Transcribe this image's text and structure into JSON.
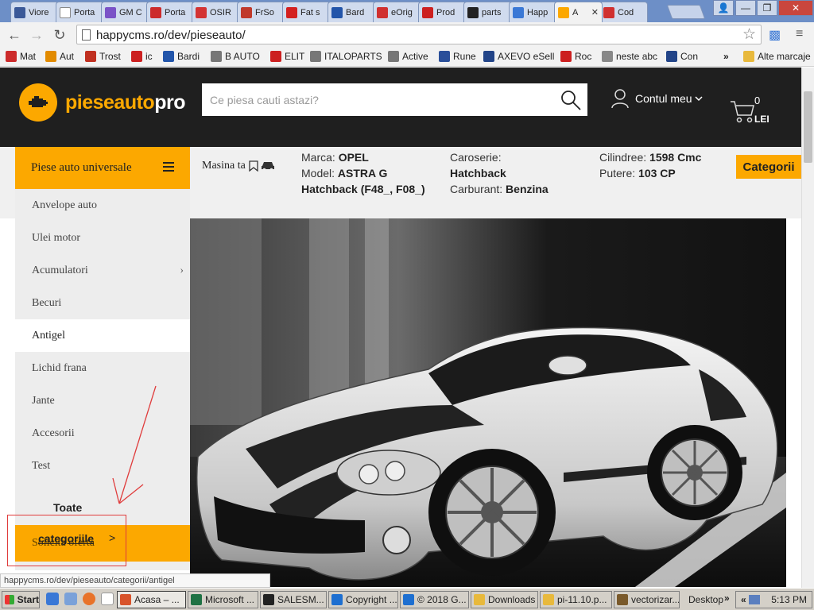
{
  "browser": {
    "tabs": [
      {
        "label": "Viore",
        "icon": "facebook-icon",
        "color": "#3b5998"
      },
      {
        "label": "Porta",
        "icon": "page-icon",
        "color": "#ffffff"
      },
      {
        "label": "GM C",
        "icon": "diamond-icon",
        "color": "#7a52c7"
      },
      {
        "label": "Porta",
        "icon": "car-icon",
        "color": "#cc2b2b"
      },
      {
        "label": "OSIR",
        "icon": "dots-icon",
        "color": "#d33333"
      },
      {
        "label": "FrSo",
        "icon": "box-icon",
        "color": "#c0392b"
      },
      {
        "label": "Fat s",
        "icon": "piese-auto-icon",
        "color": "#d32020"
      },
      {
        "label": "Bard",
        "icon": "bardi-icon",
        "color": "#2255aa"
      },
      {
        "label": "eOrig",
        "icon": "eorig-icon",
        "color": "#d03030"
      },
      {
        "label": "Prod",
        "icon": "elit-icon",
        "color": "#cc2020"
      },
      {
        "label": "parts",
        "icon": "parts24-icon",
        "color": "#222222"
      },
      {
        "label": "Happ",
        "icon": "loading-icon",
        "color": "#3a78d6"
      },
      {
        "label": "A",
        "icon": "pieseauto-icon",
        "color": "#fca800"
      },
      {
        "label": "Cod",
        "icon": "cod-icon",
        "color": "#d03030"
      }
    ],
    "url": "happycms.ro/dev/pieseauto/",
    "bookmarks": [
      {
        "label": "Mat",
        "color": "#cc2b2b"
      },
      {
        "label": "Aut",
        "color": "#e28b00"
      },
      {
        "label": "Trost",
        "color": "#c03020"
      },
      {
        "label": "ic",
        "color": "#cc2020"
      },
      {
        "label": "Bardi",
        "color": "#2255aa"
      },
      {
        "label": "B AUTO",
        "color": "#777777"
      },
      {
        "label": "ELIT",
        "color": "#cc2020"
      },
      {
        "label": "ITALOPARTS",
        "color": "#777777"
      },
      {
        "label": "Active",
        "color": "#777777"
      },
      {
        "label": "Rune",
        "color": "#2a4f9a"
      },
      {
        "label": "AXEVO eSell",
        "color": "#224488"
      },
      {
        "label": "Roc",
        "color": "#cc2020"
      },
      {
        "label": "neste abc",
        "color": "#888888"
      },
      {
        "label": "Con",
        "color": "#224488"
      }
    ],
    "bookmarks_more": "»",
    "other_bookmarks": "Alte marcaje",
    "status_url": "happycms.ro/dev/pieseauto/categorii/antigel"
  },
  "site": {
    "logo": {
      "part1": "pieseauto",
      "part2": "pro"
    },
    "search": {
      "placeholder": "Ce piesa cauti astazi?"
    },
    "account": {
      "label": "Contul meu"
    },
    "cart": {
      "count": "0",
      "currency": "LEI"
    },
    "universal_button": "Piese auto universale",
    "my_car": "Masina ta",
    "car": {
      "brand_label": "Marca:",
      "brand": "OPEL",
      "model_label": "Model:",
      "model": "ASTRA G Hatchback (F48_, F08_)",
      "body_label": "Caroserie:",
      "body": "Hatchback",
      "fuel_label": "Carburant:",
      "fuel": "Benzina",
      "cc_label": "Cilindree:",
      "cc": "1598 Cmc",
      "power_label": "Putere:",
      "power": "103 CP"
    },
    "categories_button": "Categorii",
    "categories": [
      {
        "label": "Anvelope auto",
        "has_sub": false
      },
      {
        "label": "Ulei motor",
        "has_sub": false
      },
      {
        "label": "Acumulatori",
        "has_sub": true
      },
      {
        "label": "Becuri",
        "has_sub": false
      },
      {
        "label": "Antigel",
        "has_sub": false,
        "active": true
      },
      {
        "label": "Lichid frana",
        "has_sub": false
      },
      {
        "label": "Jante",
        "has_sub": false
      },
      {
        "label": "Accesorii",
        "has_sub": false
      },
      {
        "label": "Test",
        "has_sub": false
      }
    ],
    "all_categories_top": "Toate",
    "all_categories_bottom": "categoriile",
    "offer": "Solicita oferta",
    "chevron": ">"
  },
  "taskbar": {
    "start": "Start",
    "tasks": [
      {
        "label": "Acasa – ...",
        "color": "#d8532a",
        "active": true
      },
      {
        "label": "Microsoft ...",
        "color": "#1f7244"
      },
      {
        "label": "SALESM...",
        "color": "#222222"
      },
      {
        "label": "Copyright ...",
        "color": "#1e6fd0"
      },
      {
        "label": "© 2018 G...",
        "color": "#1e6fd0"
      },
      {
        "label": "Downloads",
        "color": "#e8b93c"
      },
      {
        "label": "pi-11.10.p...",
        "color": "#e8b93c"
      },
      {
        "label": "vectorizar...",
        "color": "#7a5a2b"
      }
    ],
    "desktop": "Desktop",
    "more": "»",
    "tray_arrows": "«",
    "time": "5:13 PM"
  }
}
